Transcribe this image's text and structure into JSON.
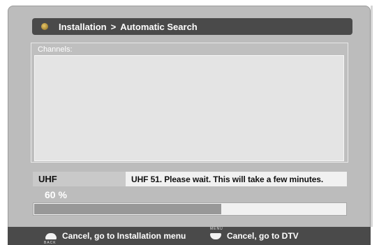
{
  "header": {
    "breadcrumb_root": "Installation",
    "breadcrumb_separator": ">",
    "breadcrumb_current": "Automatic Search",
    "logo_icon": "gold-orb-icon"
  },
  "channels": {
    "label": "Channels:",
    "items": []
  },
  "scan": {
    "band": "UHF",
    "status": "UHF 51.  Please wait. This will take a few minutes.",
    "progress_text": "60 %",
    "progress_value": 0.6
  },
  "footer": {
    "back_key_caption": "BACK",
    "back_hint": "Cancel, go to Installation menu",
    "menu_key_caption": "MENU",
    "menu_hint": "Cancel, go to DTV"
  },
  "colors": {
    "background": "#bcbcbc",
    "title_bar": "#4a4a4a",
    "progress_fill": "#989898"
  }
}
